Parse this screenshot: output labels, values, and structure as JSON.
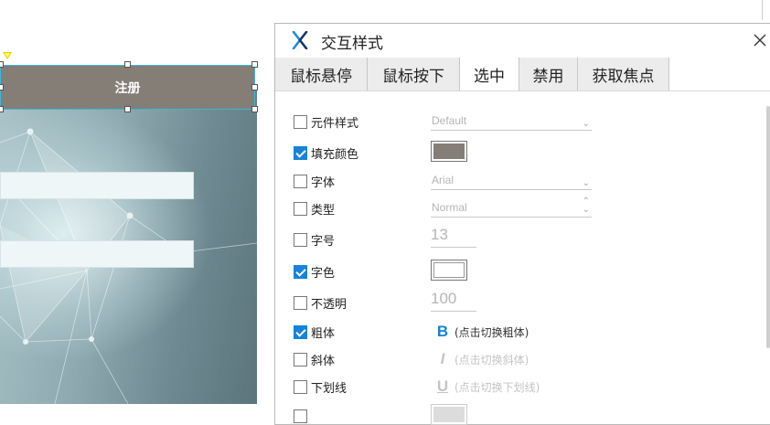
{
  "canvas": {
    "register_button_label": "注册"
  },
  "dialog": {
    "title": "交互样式",
    "app_icon": "axure-x-icon",
    "close_icon": "close-icon",
    "tabs": [
      {
        "label": "鼠标悬停",
        "active": false
      },
      {
        "label": "鼠标按下",
        "active": false
      },
      {
        "label": "选中",
        "active": true
      },
      {
        "label": "禁用",
        "active": false
      },
      {
        "label": "获取焦点",
        "active": false
      }
    ],
    "properties": {
      "widget_style": {
        "label": "元件样式",
        "checked": false,
        "value": "Default"
      },
      "fill_color": {
        "label": "填充颜色",
        "checked": true,
        "color": "#847e77"
      },
      "font": {
        "label": "字体",
        "checked": false,
        "value": "Arial"
      },
      "font_type": {
        "label": "类型",
        "checked": false,
        "value": "Normal"
      },
      "font_size": {
        "label": "字号",
        "checked": false,
        "value": "13"
      },
      "font_color": {
        "label": "字色",
        "checked": true,
        "color": "#ffffff"
      },
      "opacity": {
        "label": "不透明",
        "checked": false,
        "value": "100"
      },
      "bold": {
        "label": "粗体",
        "checked": true,
        "glyph": "B",
        "hint": "(点击切换粗体)"
      },
      "italic": {
        "label": "斜体",
        "checked": false,
        "glyph": "I",
        "hint": "(点击切换斜体)"
      },
      "underline": {
        "label": "下划线",
        "checked": false,
        "glyph": "U",
        "hint": "(点击切换下划线)"
      }
    }
  },
  "colors": {
    "accent": "#1683d8",
    "selection_border": "#3ab7d6",
    "button_fill": "#847e77"
  }
}
